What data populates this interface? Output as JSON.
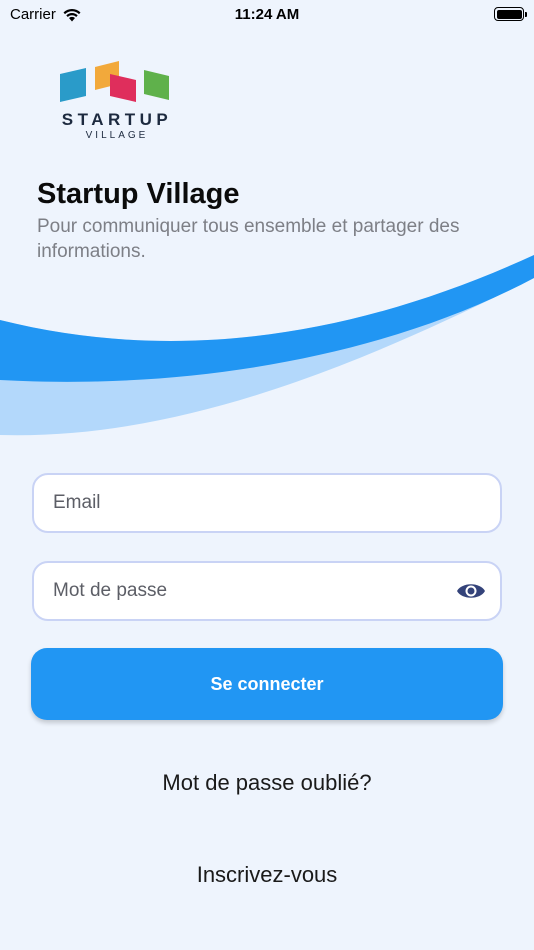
{
  "status_bar": {
    "carrier": "Carrier",
    "time": "11:24 AM",
    "wifi_icon": "wifi-icon",
    "battery_icon": "battery-icon"
  },
  "logo": {
    "wordmark": "STARTUP",
    "sub": "VILLAGE"
  },
  "header": {
    "title": "Startup Village",
    "subtitle": "Pour communiquer tous ensemble et partager des informations."
  },
  "form": {
    "email_placeholder": "Email",
    "password_placeholder": "Mot de passe",
    "toggle_visibility_icon": "eye-icon",
    "submit_label": "Se connecter"
  },
  "links": {
    "forgot_password": "Mot de passe oublié?",
    "register": "Inscrivez-vous"
  },
  "colors": {
    "background": "#eef4fd",
    "primary": "#2196f3",
    "wave_light": "#b3d8fb",
    "input_border": "#c9d3f5",
    "eye_icon": "#34437a"
  }
}
